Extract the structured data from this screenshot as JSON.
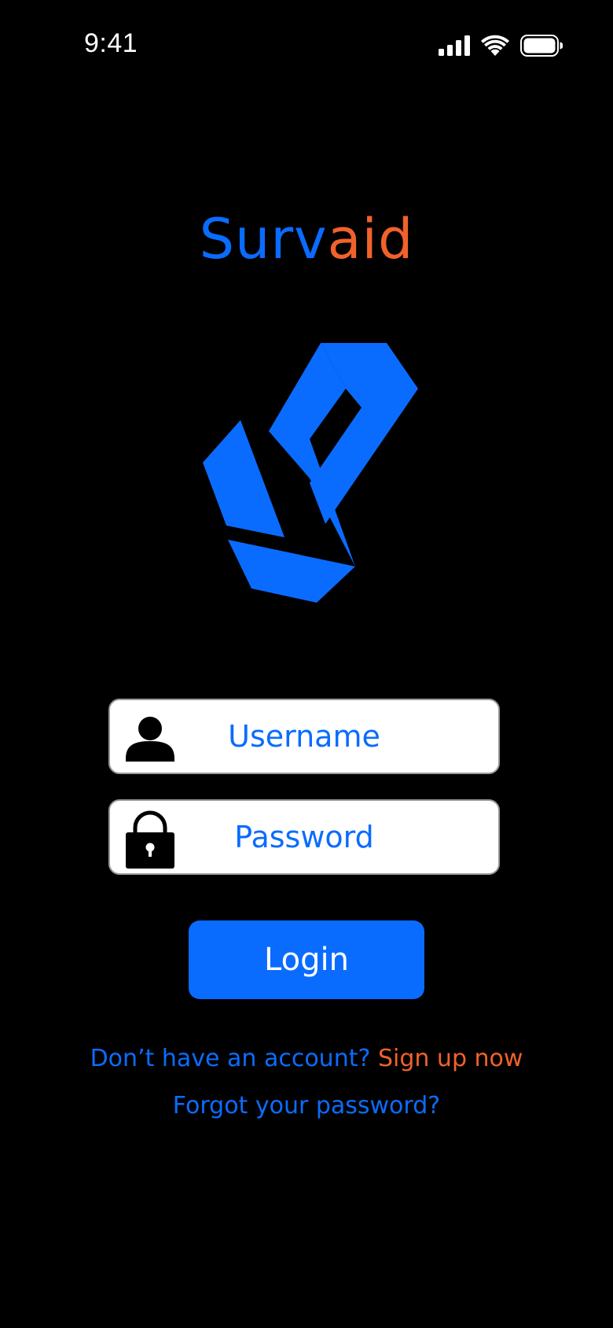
{
  "status_bar": {
    "time": "9:41",
    "icons": [
      "cellular-signal-icon",
      "wifi-icon",
      "battery-icon"
    ]
  },
  "brand": {
    "part_a": "Surv",
    "part_b": "aid",
    "color_a": "#0a6cff",
    "color_b": "#f0622a"
  },
  "logo": {
    "icon": "survaid-logo-icon",
    "color": "#0a6cff"
  },
  "form": {
    "username": {
      "placeholder": "Username",
      "icon": "user-icon"
    },
    "password": {
      "placeholder": "Password",
      "icon": "lock-icon"
    },
    "login_label": "Login"
  },
  "footer": {
    "prompt": "Don’t have an account?",
    "signup_label": "Sign up now",
    "forgot_label": "Forgot your password?"
  },
  "colors": {
    "background": "#000000",
    "accent": "#0a6cff",
    "highlight": "#f0622a"
  }
}
